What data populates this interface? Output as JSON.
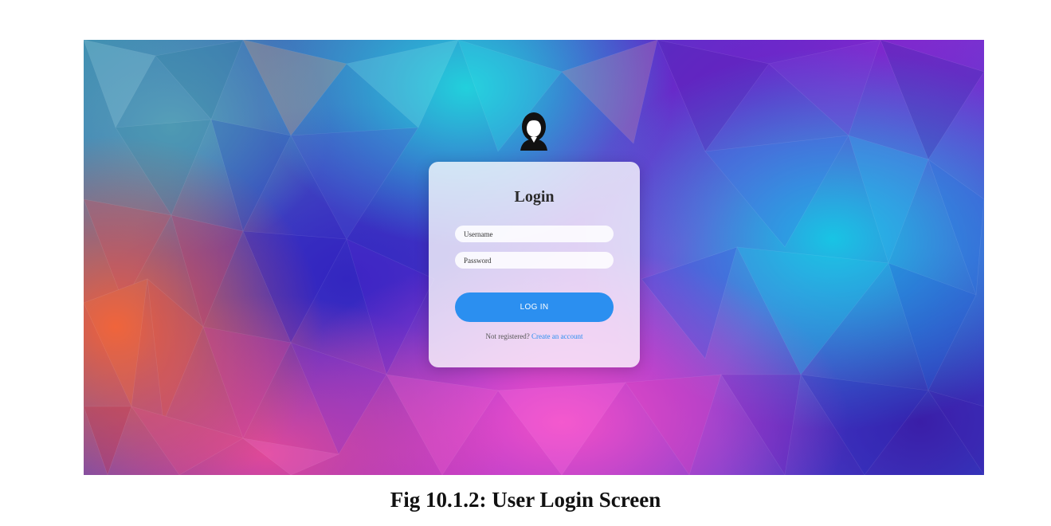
{
  "login_card": {
    "title": "Login",
    "username_placeholder": "Username",
    "password_placeholder": "Password",
    "login_button_label": "LOG IN",
    "register_prompt": "Not registered?",
    "register_link_label": "Create an account"
  },
  "avatar": {
    "icon": "user-avatar-icon"
  },
  "caption": "Fig 10.1.2: User Login Screen",
  "colors": {
    "accent": "#2b8ff0",
    "card_background": "#ffffffc7",
    "title_text": "#2a2a2a"
  }
}
